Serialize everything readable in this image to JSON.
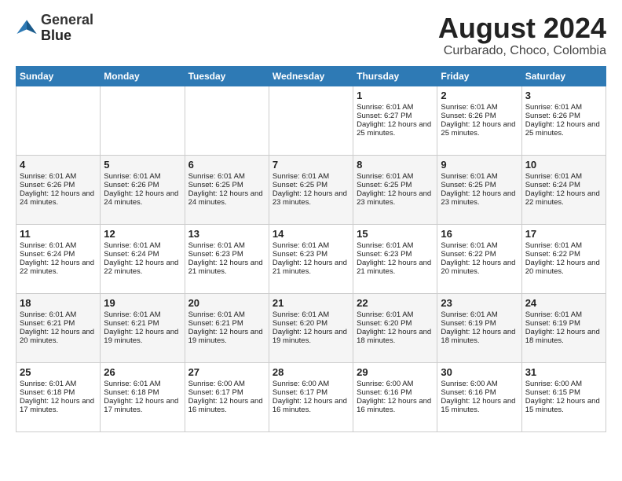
{
  "header": {
    "logo_line1": "General",
    "logo_line2": "Blue",
    "month_title": "August 2024",
    "location": "Curbarado, Choco, Colombia"
  },
  "days_of_week": [
    "Sunday",
    "Monday",
    "Tuesday",
    "Wednesday",
    "Thursday",
    "Friday",
    "Saturday"
  ],
  "weeks": [
    [
      {
        "day": "",
        "sunrise": "",
        "sunset": "",
        "daylight": ""
      },
      {
        "day": "",
        "sunrise": "",
        "sunset": "",
        "daylight": ""
      },
      {
        "day": "",
        "sunrise": "",
        "sunset": "",
        "daylight": ""
      },
      {
        "day": "",
        "sunrise": "",
        "sunset": "",
        "daylight": ""
      },
      {
        "day": "1",
        "sunrise": "Sunrise: 6:01 AM",
        "sunset": "Sunset: 6:27 PM",
        "daylight": "Daylight: 12 hours and 25 minutes."
      },
      {
        "day": "2",
        "sunrise": "Sunrise: 6:01 AM",
        "sunset": "Sunset: 6:26 PM",
        "daylight": "Daylight: 12 hours and 25 minutes."
      },
      {
        "day": "3",
        "sunrise": "Sunrise: 6:01 AM",
        "sunset": "Sunset: 6:26 PM",
        "daylight": "Daylight: 12 hours and 25 minutes."
      }
    ],
    [
      {
        "day": "4",
        "sunrise": "Sunrise: 6:01 AM",
        "sunset": "Sunset: 6:26 PM",
        "daylight": "Daylight: 12 hours and 24 minutes."
      },
      {
        "day": "5",
        "sunrise": "Sunrise: 6:01 AM",
        "sunset": "Sunset: 6:26 PM",
        "daylight": "Daylight: 12 hours and 24 minutes."
      },
      {
        "day": "6",
        "sunrise": "Sunrise: 6:01 AM",
        "sunset": "Sunset: 6:25 PM",
        "daylight": "Daylight: 12 hours and 24 minutes."
      },
      {
        "day": "7",
        "sunrise": "Sunrise: 6:01 AM",
        "sunset": "Sunset: 6:25 PM",
        "daylight": "Daylight: 12 hours and 23 minutes."
      },
      {
        "day": "8",
        "sunrise": "Sunrise: 6:01 AM",
        "sunset": "Sunset: 6:25 PM",
        "daylight": "Daylight: 12 hours and 23 minutes."
      },
      {
        "day": "9",
        "sunrise": "Sunrise: 6:01 AM",
        "sunset": "Sunset: 6:25 PM",
        "daylight": "Daylight: 12 hours and 23 minutes."
      },
      {
        "day": "10",
        "sunrise": "Sunrise: 6:01 AM",
        "sunset": "Sunset: 6:24 PM",
        "daylight": "Daylight: 12 hours and 22 minutes."
      }
    ],
    [
      {
        "day": "11",
        "sunrise": "Sunrise: 6:01 AM",
        "sunset": "Sunset: 6:24 PM",
        "daylight": "Daylight: 12 hours and 22 minutes."
      },
      {
        "day": "12",
        "sunrise": "Sunrise: 6:01 AM",
        "sunset": "Sunset: 6:24 PM",
        "daylight": "Daylight: 12 hours and 22 minutes."
      },
      {
        "day": "13",
        "sunrise": "Sunrise: 6:01 AM",
        "sunset": "Sunset: 6:23 PM",
        "daylight": "Daylight: 12 hours and 21 minutes."
      },
      {
        "day": "14",
        "sunrise": "Sunrise: 6:01 AM",
        "sunset": "Sunset: 6:23 PM",
        "daylight": "Daylight: 12 hours and 21 minutes."
      },
      {
        "day": "15",
        "sunrise": "Sunrise: 6:01 AM",
        "sunset": "Sunset: 6:23 PM",
        "daylight": "Daylight: 12 hours and 21 minutes."
      },
      {
        "day": "16",
        "sunrise": "Sunrise: 6:01 AM",
        "sunset": "Sunset: 6:22 PM",
        "daylight": "Daylight: 12 hours and 20 minutes."
      },
      {
        "day": "17",
        "sunrise": "Sunrise: 6:01 AM",
        "sunset": "Sunset: 6:22 PM",
        "daylight": "Daylight: 12 hours and 20 minutes."
      }
    ],
    [
      {
        "day": "18",
        "sunrise": "Sunrise: 6:01 AM",
        "sunset": "Sunset: 6:21 PM",
        "daylight": "Daylight: 12 hours and 20 minutes."
      },
      {
        "day": "19",
        "sunrise": "Sunrise: 6:01 AM",
        "sunset": "Sunset: 6:21 PM",
        "daylight": "Daylight: 12 hours and 19 minutes."
      },
      {
        "day": "20",
        "sunrise": "Sunrise: 6:01 AM",
        "sunset": "Sunset: 6:21 PM",
        "daylight": "Daylight: 12 hours and 19 minutes."
      },
      {
        "day": "21",
        "sunrise": "Sunrise: 6:01 AM",
        "sunset": "Sunset: 6:20 PM",
        "daylight": "Daylight: 12 hours and 19 minutes."
      },
      {
        "day": "22",
        "sunrise": "Sunrise: 6:01 AM",
        "sunset": "Sunset: 6:20 PM",
        "daylight": "Daylight: 12 hours and 18 minutes."
      },
      {
        "day": "23",
        "sunrise": "Sunrise: 6:01 AM",
        "sunset": "Sunset: 6:19 PM",
        "daylight": "Daylight: 12 hours and 18 minutes."
      },
      {
        "day": "24",
        "sunrise": "Sunrise: 6:01 AM",
        "sunset": "Sunset: 6:19 PM",
        "daylight": "Daylight: 12 hours and 18 minutes."
      }
    ],
    [
      {
        "day": "25",
        "sunrise": "Sunrise: 6:01 AM",
        "sunset": "Sunset: 6:18 PM",
        "daylight": "Daylight: 12 hours and 17 minutes."
      },
      {
        "day": "26",
        "sunrise": "Sunrise: 6:01 AM",
        "sunset": "Sunset: 6:18 PM",
        "daylight": "Daylight: 12 hours and 17 minutes."
      },
      {
        "day": "27",
        "sunrise": "Sunrise: 6:00 AM",
        "sunset": "Sunset: 6:17 PM",
        "daylight": "Daylight: 12 hours and 16 minutes."
      },
      {
        "day": "28",
        "sunrise": "Sunrise: 6:00 AM",
        "sunset": "Sunset: 6:17 PM",
        "daylight": "Daylight: 12 hours and 16 minutes."
      },
      {
        "day": "29",
        "sunrise": "Sunrise: 6:00 AM",
        "sunset": "Sunset: 6:16 PM",
        "daylight": "Daylight: 12 hours and 16 minutes."
      },
      {
        "day": "30",
        "sunrise": "Sunrise: 6:00 AM",
        "sunset": "Sunset: 6:16 PM",
        "daylight": "Daylight: 12 hours and 15 minutes."
      },
      {
        "day": "31",
        "sunrise": "Sunrise: 6:00 AM",
        "sunset": "Sunset: 6:15 PM",
        "daylight": "Daylight: 12 hours and 15 minutes."
      }
    ]
  ]
}
